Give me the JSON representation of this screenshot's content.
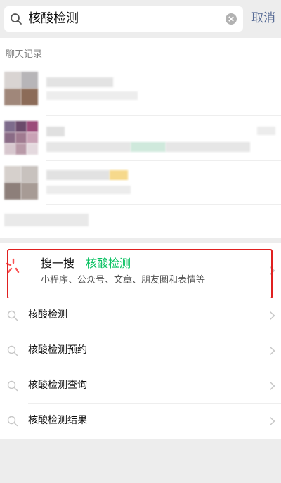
{
  "search": {
    "query": "核酸检测",
    "cancel_label": "取消"
  },
  "chat_section": {
    "title": "聊天记录"
  },
  "souyisou": {
    "title": "搜一搜",
    "keyword": "核酸检测",
    "subtitle": "小程序、公众号、文章、朋友圈和表情等"
  },
  "suggestions": [
    "核酸检测",
    "核酸检测预约",
    "核酸检测查询",
    "核酸检测结果"
  ],
  "colors": {
    "accent_green": "#07c160",
    "link_blue": "#576b95",
    "highlight_red": "#e02020"
  }
}
